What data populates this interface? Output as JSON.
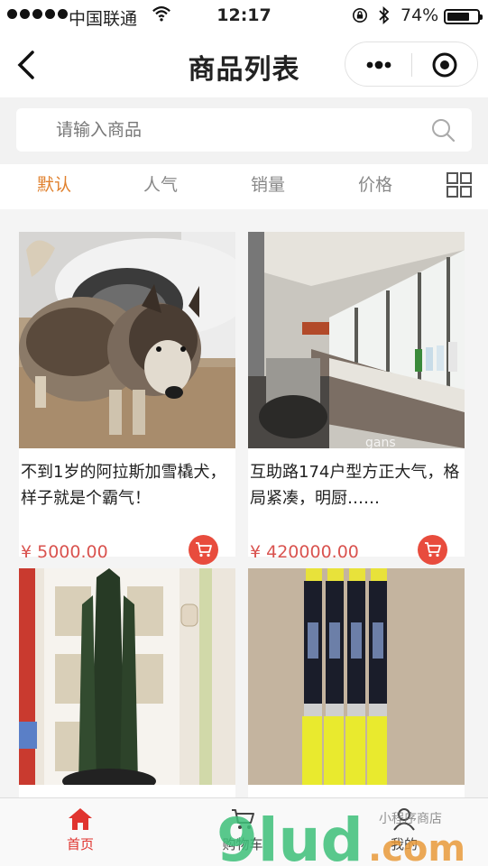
{
  "status_bar": {
    "carrier": "中国联通",
    "time": "12:17",
    "battery": "74%",
    "battery_level": 0.74
  },
  "nav": {
    "title": "商品列表"
  },
  "search": {
    "placeholder": "请输入商品"
  },
  "sort_tabs": [
    {
      "label": "默认",
      "active": true
    },
    {
      "label": "人气",
      "active": false
    },
    {
      "label": "销量",
      "active": false
    },
    {
      "label": "价格",
      "active": false
    }
  ],
  "products": [
    {
      "name": "不到1岁的阿拉斯加雪橇犬，样子就是个霸气！",
      "price": "¥ 5000.00"
    },
    {
      "name": "互助路174户型方正大气，格局紧凑，明厨……",
      "price": "¥ 420000.00"
    },
    {
      "name": "",
      "price": ""
    },
    {
      "name": "",
      "price": ""
    }
  ],
  "tabbar": [
    {
      "label": "首页",
      "icon": "home-icon",
      "active": true
    },
    {
      "label": "购物车",
      "icon": "cart-icon",
      "active": false
    },
    {
      "label": "我的",
      "icon": "user-icon",
      "active": false
    }
  ],
  "watermark": {
    "brand": "9lud",
    "suffix": ".com",
    "tagline": "小程序商店"
  },
  "colors": {
    "accent": "#e0802d",
    "price": "#d9534f",
    "cart": "#e84c3d",
    "tab_active": "#e0342f"
  }
}
